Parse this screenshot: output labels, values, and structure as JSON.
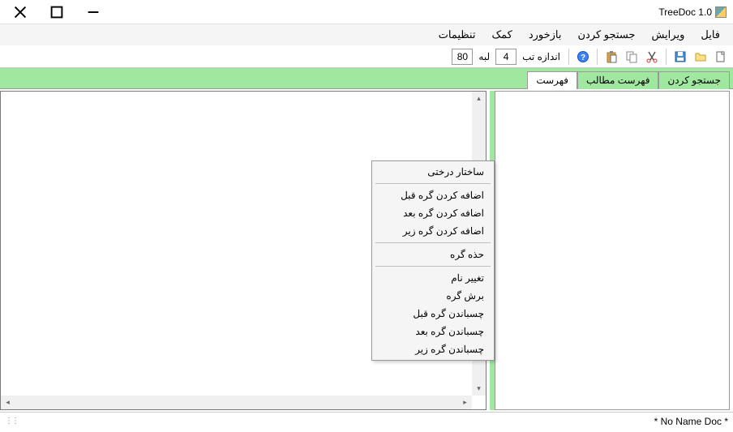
{
  "title": "TreeDoc 1.0",
  "menubar": {
    "file": "فایل",
    "edit": "ویرایش",
    "search": "جستجو کردن",
    "feedback": "بازخورد",
    "help": "کمک",
    "settings": "تنظیمات"
  },
  "toolbar": {
    "tab_size_label": "اندازه تب",
    "tab_size_value": "4",
    "margin_label": "لبه",
    "margin_value": "80"
  },
  "tabs": {
    "search": "جستجو کردن",
    "toc": "فهرست مطالب",
    "index": "فهرست"
  },
  "context_menu": {
    "tree_structure": "ساختار درختی",
    "add_node_before": "اضافه کردن گره قبل",
    "add_node_after": "اضافه کردن گره بعد",
    "add_node_below": "اضافه کردن گره زیر",
    "delete_node": "حذه گره",
    "rename": "تغییر نام",
    "cut_node": "برش گره",
    "paste_before": "چسباندن گره قبل",
    "paste_after": "چسباندن گره بعد",
    "paste_below": "چسباندن گره زیر"
  },
  "status": {
    "doc_name": "* No Name Doc *"
  }
}
